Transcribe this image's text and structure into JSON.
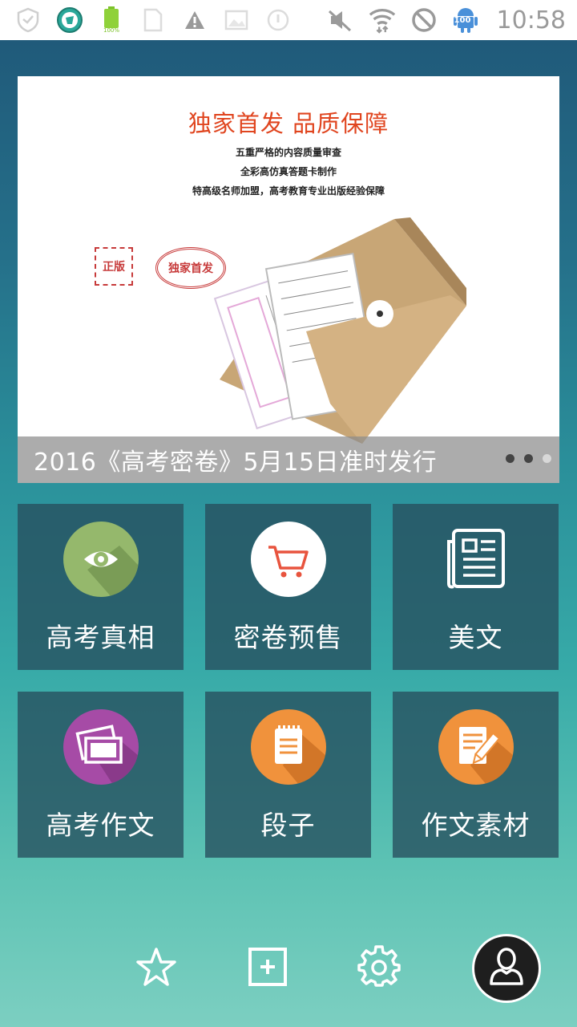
{
  "status_bar": {
    "time": "10:58",
    "battery_label": "100%",
    "notification_badge": "100",
    "icons": [
      "shield-outline-icon",
      "security-app-icon",
      "battery-icon",
      "file-icon",
      "warning-icon",
      "image-icon",
      "circle-icon",
      "mute-icon",
      "wifi-icon",
      "no-signal-icon",
      "android-icon"
    ]
  },
  "banner": {
    "headline": "独家首发  品质保障",
    "lines": [
      "五重严格的内容质量审查",
      "全彩高仿真答题卡制作",
      "特高级名师加盟，高考教育专业出版经验保障"
    ],
    "stamp_left": "正版",
    "stamp_right": "独家首发",
    "caption": "2016《高考密卷》5月15日准时发行",
    "slide_count": 3,
    "active_slide": 1
  },
  "tiles": [
    {
      "label": "高考真相",
      "icon": "eye-icon",
      "color": "#95b86c"
    },
    {
      "label": "密卷预售",
      "icon": "cart-icon",
      "color": "#ffffff"
    },
    {
      "label": "美文",
      "icon": "newspaper-icon",
      "color": "transparent"
    },
    {
      "label": "高考作文",
      "icon": "cards-icon",
      "color": "#a64ba6"
    },
    {
      "label": "段子",
      "icon": "notepad-icon",
      "color": "#f0923c"
    },
    {
      "label": "作文素材",
      "icon": "pencil-doc-icon",
      "color": "#f0923c"
    }
  ],
  "bottom_bar": {
    "buttons": [
      "star-icon",
      "add-icon",
      "settings-icon",
      "profile-icon"
    ]
  }
}
